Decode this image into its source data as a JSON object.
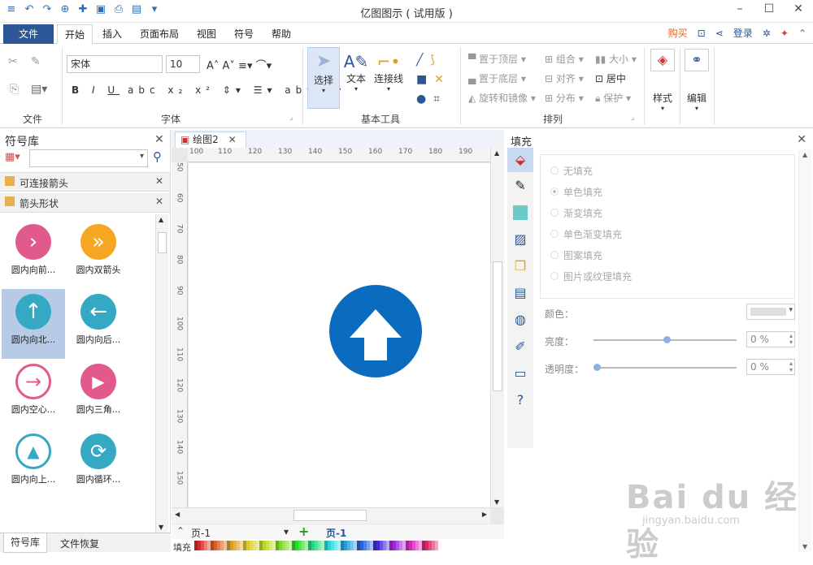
{
  "app": {
    "title": "亿图图示 ( 试用版 )"
  },
  "qat": [
    "≡",
    "↶",
    "↷",
    "⊕",
    "✚",
    "▣",
    "⎙",
    "▤",
    "▾"
  ],
  "tabs": [
    "开始",
    "插入",
    "页面布局",
    "视图",
    "符号",
    "帮助"
  ],
  "file_tab": "文件",
  "right_tabs": {
    "buy": "购买",
    "login": "登录"
  },
  "ribbon": {
    "font": {
      "family": "宋体",
      "size": "10",
      "label": "字体"
    },
    "file_label": "文件",
    "tools": {
      "select": "选择",
      "text": "文本",
      "connector": "连接线",
      "label": "基本工具"
    },
    "arrange": {
      "bring_top": "置于顶层",
      "send_bottom": "置于底层",
      "rotate": "旋转和镜像",
      "group": "组合",
      "align": "对齐",
      "distribute": "分布",
      "size": "大小",
      "center": "居中",
      "protect": "保护",
      "label": "排列"
    },
    "style": "样式",
    "edit": "编辑"
  },
  "left": {
    "title": "符号库",
    "libs": [
      "可连接箭头",
      "箭头形状"
    ],
    "items": [
      {
        "label": "圆内向前...",
        "color": "#e05a8c",
        "glyph": "›"
      },
      {
        "label": "圆内双箭头",
        "color": "#f5a623",
        "glyph": "»"
      },
      {
        "label": "圆内向北...",
        "color": "#35a8c4",
        "glyph": "↑"
      },
      {
        "label": "圆内向后...",
        "color": "#35a8c4",
        "glyph": "←"
      },
      {
        "label": "圆内空心...",
        "color": "#e05a8c",
        "glyph": "→"
      },
      {
        "label": "圆内三角...",
        "color": "#e05a8c",
        "glyph": "▶"
      },
      {
        "label": "圆内向上...",
        "color": "#35a8c4",
        "glyph": "▲"
      },
      {
        "label": "圆内循环...",
        "color": "#35a8c4",
        "glyph": "⟳"
      }
    ],
    "bottom_tabs": [
      "符号库",
      "文件恢复"
    ]
  },
  "doc": {
    "tab": "绘图2",
    "page": "页-1",
    "page_tab": "页-1",
    "fill_label": "填充"
  },
  "ruler": {
    "h": [
      "100",
      "110",
      "120",
      "130",
      "140",
      "150",
      "160",
      "170",
      "180",
      "190"
    ],
    "v": [
      "50",
      "60",
      "70",
      "80",
      "90",
      "100",
      "110",
      "120",
      "130",
      "140",
      "150"
    ]
  },
  "fill": {
    "title": "填充",
    "options": [
      "无填充",
      "单色填充",
      "渐变填充",
      "单色渐变填充",
      "图案填充",
      "图片或纹理填充"
    ],
    "color_label": "颜色：",
    "brightness_label": "亮度：",
    "brightness": "0 %",
    "transparency_label": "透明度：",
    "transparency": "0 %"
  },
  "watermark": {
    "main": "Bai du 经验",
    "sub": "jingyan.baidu.com"
  },
  "colors": {
    "accent": "#2b5797",
    "shape": "#0b6cbf"
  }
}
